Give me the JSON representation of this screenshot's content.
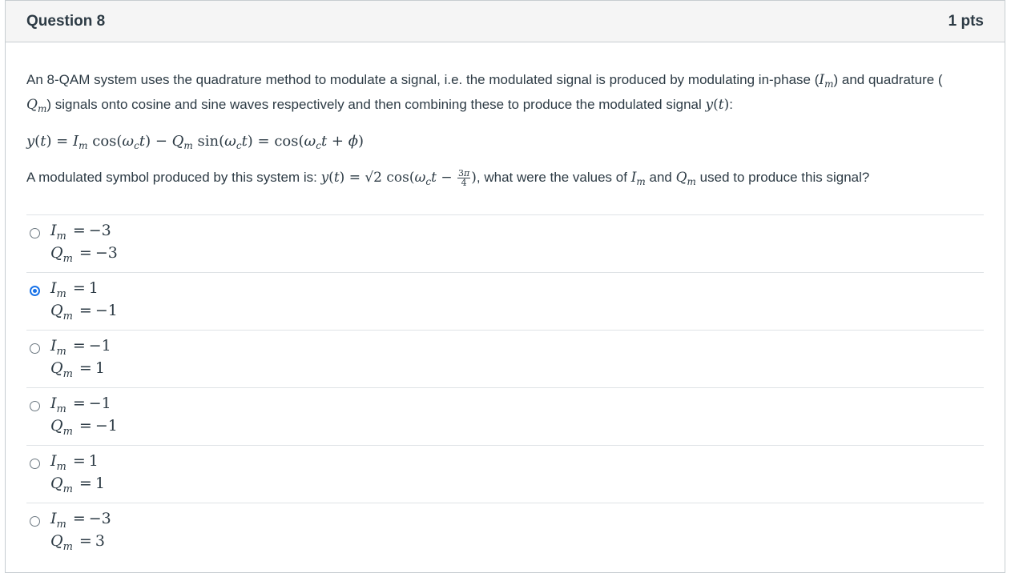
{
  "question": {
    "title": "Question 8",
    "points": "1 pts"
  },
  "intro": {
    "p1": "An 8-QAM system uses the quadrature method to modulate a signal, i.e. the modulated signal is produced by modulating in-phase (",
    "p2": ") and quadrature (",
    "p3": ") signals onto cosine and sine waves respectively and then combining these to produce the modulated signal ",
    "p4": ":"
  },
  "equation": {
    "lhs": "y(t)",
    "rhs": " = Iₘ cos(ωᴄt) − Qₘ sin(ωᴄt) = cos(ωᴄt + ϕ)"
  },
  "symbol_text": {
    "prefix": "A modulated symbol produced by this system is: ",
    "suffix": ", what were the values of ",
    "and": " and ",
    "end": " used to produce this signal?"
  },
  "answers": [
    {
      "im": "−3",
      "qm": "−3",
      "selected": false
    },
    {
      "im": "1",
      "qm": "−1",
      "selected": true
    },
    {
      "im": "−1",
      "qm": "1",
      "selected": false
    },
    {
      "im": "−1",
      "qm": "−1",
      "selected": false
    },
    {
      "im": "1",
      "qm": "1",
      "selected": false
    },
    {
      "im": "−3",
      "qm": "3",
      "selected": false
    }
  ],
  "colors": {
    "accent": "#1a73e8",
    "header_bg": "#f5f5f5",
    "text": "#2d3b45"
  }
}
